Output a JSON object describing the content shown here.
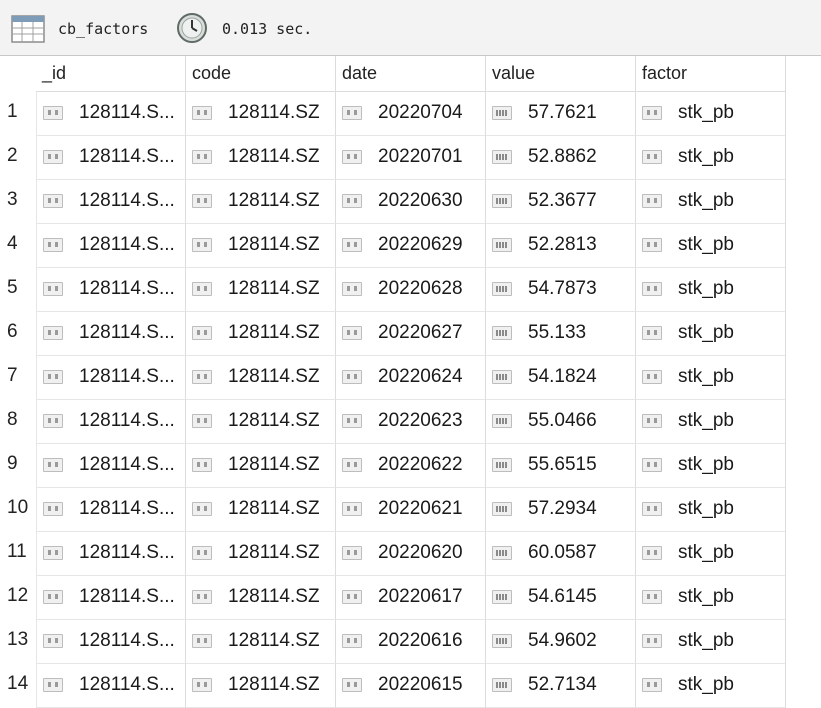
{
  "toolbar": {
    "collection_name": "cb_factors",
    "query_time": "0.013 sec.",
    "table_icon": "table-grid-icon",
    "clock_icon": "clock-icon"
  },
  "columns": [
    "_id",
    "code",
    "date",
    "value",
    "factor"
  ],
  "rows": [
    {
      "num": "1",
      "id": "128114.S...",
      "code": "128114.SZ",
      "date": "20220704",
      "value": "57.7621",
      "factor": "stk_pb"
    },
    {
      "num": "2",
      "id": "128114.S...",
      "code": "128114.SZ",
      "date": "20220701",
      "value": "52.8862",
      "factor": "stk_pb"
    },
    {
      "num": "3",
      "id": "128114.S...",
      "code": "128114.SZ",
      "date": "20220630",
      "value": "52.3677",
      "factor": "stk_pb"
    },
    {
      "num": "4",
      "id": "128114.S...",
      "code": "128114.SZ",
      "date": "20220629",
      "value": "52.2813",
      "factor": "stk_pb"
    },
    {
      "num": "5",
      "id": "128114.S...",
      "code": "128114.SZ",
      "date": "20220628",
      "value": "54.7873",
      "factor": "stk_pb"
    },
    {
      "num": "6",
      "id": "128114.S...",
      "code": "128114.SZ",
      "date": "20220627",
      "value": "55.133",
      "factor": "stk_pb"
    },
    {
      "num": "7",
      "id": "128114.S...",
      "code": "128114.SZ",
      "date": "20220624",
      "value": "54.1824",
      "factor": "stk_pb"
    },
    {
      "num": "8",
      "id": "128114.S...",
      "code": "128114.SZ",
      "date": "20220623",
      "value": "55.0466",
      "factor": "stk_pb"
    },
    {
      "num": "9",
      "id": "128114.S...",
      "code": "128114.SZ",
      "date": "20220622",
      "value": "55.6515",
      "factor": "stk_pb"
    },
    {
      "num": "10",
      "id": "128114.S...",
      "code": "128114.SZ",
      "date": "20220621",
      "value": "57.2934",
      "factor": "stk_pb"
    },
    {
      "num": "11",
      "id": "128114.S...",
      "code": "128114.SZ",
      "date": "20220620",
      "value": "60.0587",
      "factor": "stk_pb"
    },
    {
      "num": "12",
      "id": "128114.S...",
      "code": "128114.SZ",
      "date": "20220617",
      "value": "54.6145",
      "factor": "stk_pb"
    },
    {
      "num": "13",
      "id": "128114.S...",
      "code": "128114.SZ",
      "date": "20220616",
      "value": "54.9602",
      "factor": "stk_pb"
    },
    {
      "num": "14",
      "id": "128114.S...",
      "code": "128114.SZ",
      "date": "20220615",
      "value": "52.7134",
      "factor": "stk_pb"
    }
  ]
}
